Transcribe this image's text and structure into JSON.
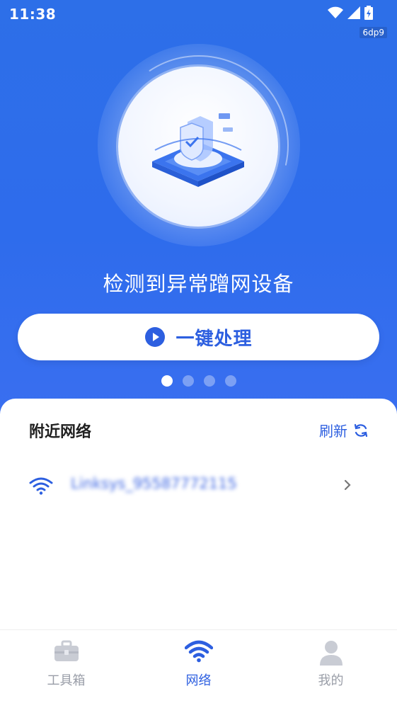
{
  "status_bar": {
    "time": "11:38",
    "badge": "6dp9"
  },
  "hero": {
    "alert_text": "检测到异常蹭网设备",
    "action_button_label": "一键处理",
    "carousel_dots": 4,
    "carousel_active_index": 0
  },
  "nearby": {
    "title": "附近网络",
    "refresh_label": "刷新",
    "networks": [
      {
        "name": "Linksys_95587772115"
      }
    ]
  },
  "tabs": [
    {
      "label": "工具箱",
      "icon": "toolbox-icon",
      "active": false
    },
    {
      "label": "网络",
      "icon": "wifi-icon",
      "active": true
    },
    {
      "label": "我的",
      "icon": "user-icon",
      "active": false
    }
  ],
  "colors": {
    "primary": "#2d5fe0",
    "hero_bg": "#2e6cec",
    "inactive": "#9a9ea8"
  }
}
